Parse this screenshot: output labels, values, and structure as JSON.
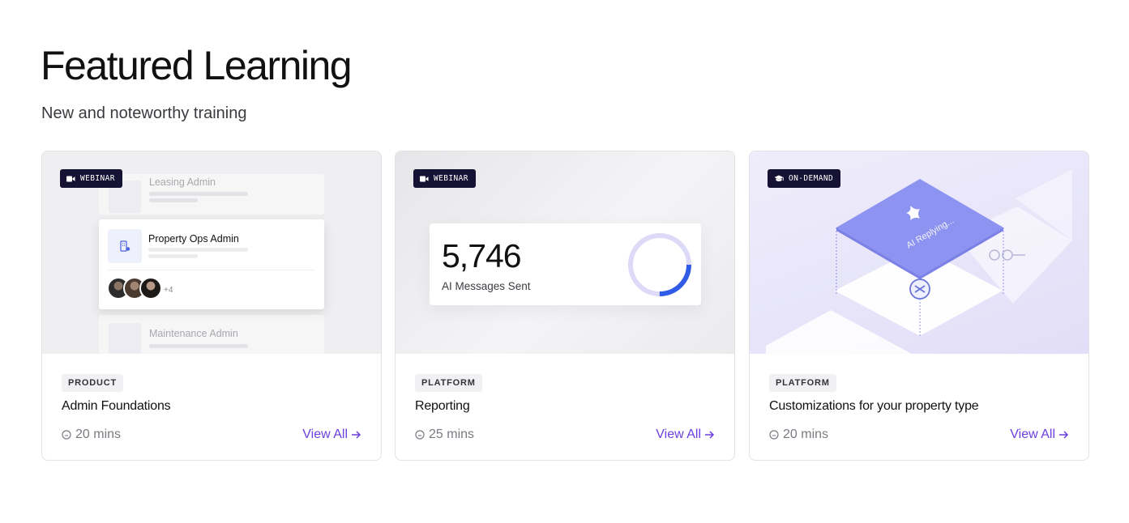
{
  "header": {
    "title": "Featured Learning",
    "subtitle": "New and noteworthy training"
  },
  "cards": [
    {
      "format": "WEBINAR",
      "format_icon": "video-camera-icon",
      "category": "PRODUCT",
      "title": "Admin Foundations",
      "duration": "20 mins",
      "action": "View All",
      "illustration": {
        "ghost_top_label": "Leasing Admin",
        "main_label": "Property Ops Admin",
        "avatar_extra": "+4",
        "ghost_bottom_label": "Maintenance Admin"
      }
    },
    {
      "format": "WEBINAR",
      "format_icon": "video-camera-icon",
      "category": "PLATFORM",
      "title": "Reporting",
      "duration": "25 mins",
      "action": "View All",
      "illustration": {
        "stat_value": "5,746",
        "stat_label": "AI Messages Sent",
        "donut_progress_fraction": 0.25
      }
    },
    {
      "format": "ON-DEMAND",
      "format_icon": "graduation-cap-icon",
      "category": "PLATFORM",
      "title": "Customizations for your property type",
      "duration": "20 mins",
      "action": "View All",
      "illustration": {
        "tile_label": "AI Replying..."
      }
    }
  ],
  "colors": {
    "accent": "#6b3fe0",
    "badge_bg": "#151233",
    "donut_track": "#dcdaf6",
    "donut_fill": "#2f5be6",
    "tile_purple": "#8d93f0"
  }
}
